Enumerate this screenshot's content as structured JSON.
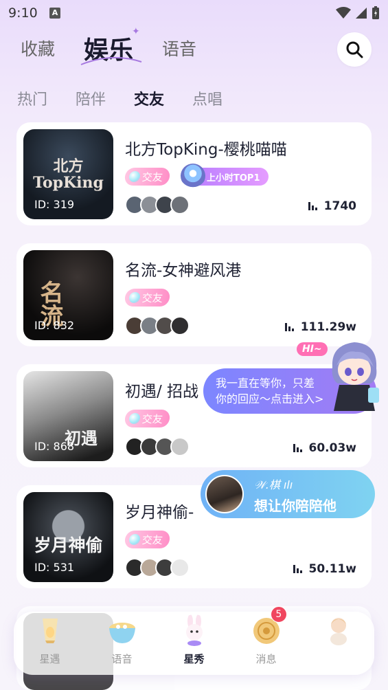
{
  "status_bar": {
    "time": "9:10",
    "notif_letter": "A"
  },
  "top_tabs": [
    "收藏",
    "娱乐",
    "语音"
  ],
  "sub_tabs": [
    "热门",
    "陪伴",
    "交友",
    "点唱"
  ],
  "rooms": [
    {
      "title": "北方TopKing-樱桃喵喵",
      "cover_text": "北方\nTopKing",
      "id": "ID: 319",
      "tag": "交友",
      "rank_badge": "上小时TOP1",
      "heat": "1740"
    },
    {
      "title": "名流-女神避风港",
      "cover_text": "名流",
      "id": "ID: 832",
      "tag": "交友",
      "heat": "111.29w"
    },
    {
      "title": "初遇/ 招战",
      "cover_text": "初遇",
      "id": "ID: 868",
      "tag": "交友",
      "heat": "60.03w"
    },
    {
      "title": "岁月神偷-",
      "cover_text": "岁月神偷",
      "id": "ID: 531",
      "tag": "交友",
      "heat": "50.11w"
    }
  ],
  "invite_bubble": {
    "badge": "HI~",
    "line1": "我一直在等你，只差",
    "line2": "你的回应～点击进入>"
  },
  "accompany_bubble": {
    "name": "𝒲.棋 ılı",
    "text": "想让你陪陪他"
  },
  "bottom_tabs": [
    {
      "label": "星遇",
      "icon": "lantern-icon"
    },
    {
      "label": "语音",
      "icon": "bowl-icon"
    },
    {
      "label": "星秀",
      "icon": "bunny-icon"
    },
    {
      "label": "消息",
      "icon": "mooncake-icon",
      "badge": "5"
    },
    {
      "label": "",
      "icon": "baby-icon"
    }
  ],
  "active_top_tab": "娱乐",
  "active_sub_tab": "交友",
  "active_bottom_tab": "星秀",
  "colors": {
    "accent_purple": "#a779e0",
    "tag_pink": "#ff8fc7",
    "bubble_blue": "#7c86ff",
    "badge_red": "#f0465f"
  }
}
